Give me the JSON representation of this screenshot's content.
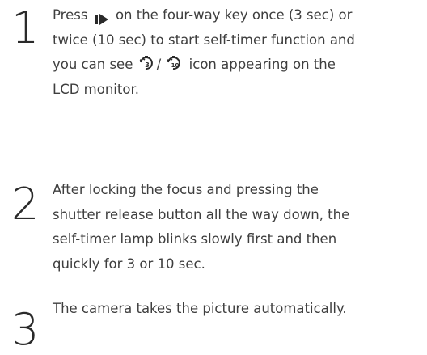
{
  "steps": [
    {
      "number": "1",
      "line1_before": "Press",
      "line1_after": "on the four-way key once (3 sec) or",
      "line2": "twice (10 sec) to start self-timer function and",
      "line3_before": "you can see",
      "line3_sep": "/",
      "line3_after": "icon appearing on the",
      "line4": "LCD monitor.",
      "icons": [
        "play-right-icon",
        "self-timer-3s-icon",
        "self-timer-10s-icon"
      ]
    },
    {
      "number": "2",
      "lines": [
        "After locking the focus and pressing the",
        "shutter release button all the way down, the",
        "self-timer lamp blinks slowly first and then",
        "quickly for 3 or 10 sec."
      ]
    },
    {
      "number": "3",
      "lines": [
        "The camera takes the picture automatically."
      ]
    }
  ],
  "timer_icon_labels": {
    "three": "3",
    "ten": "10"
  }
}
